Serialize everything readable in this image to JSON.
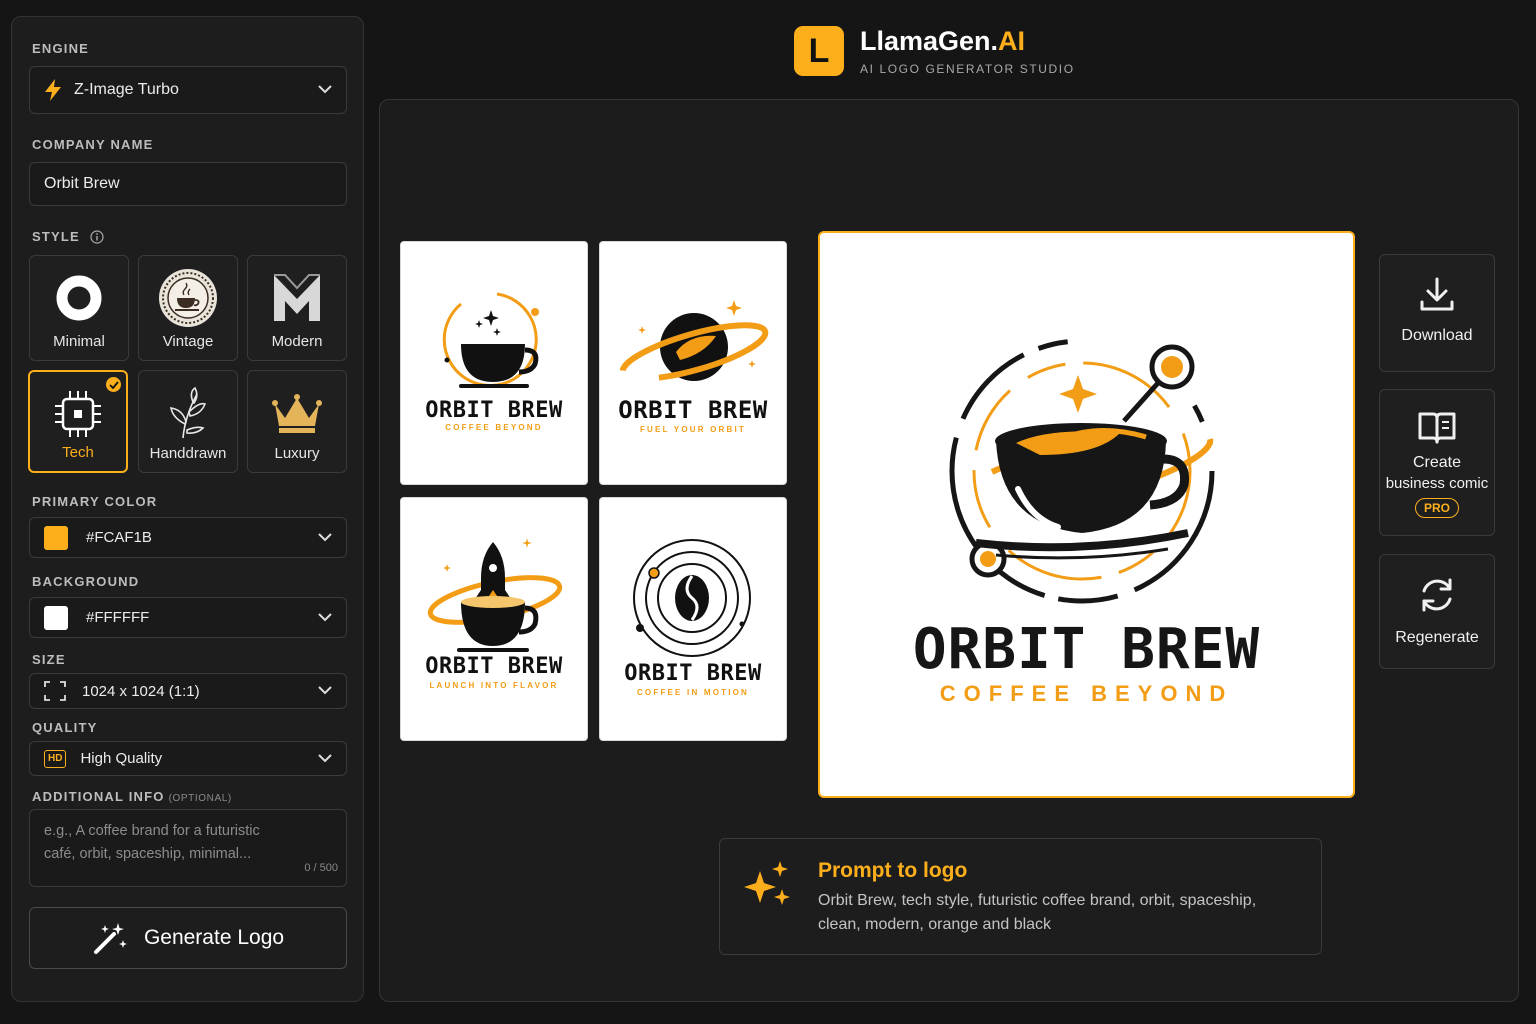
{
  "brand": {
    "name": "LlamaGen.",
    "name_suffix": "AI",
    "subtitle": "AI LOGO GENERATOR STUDIO",
    "mark_letter": "L"
  },
  "sidebar": {
    "engine_label": "ENGINE",
    "engine_value": "Z-Image Turbo",
    "company_label": "COMPANY NAME",
    "company_value": "Orbit Brew",
    "style_label": "STYLE",
    "styles": [
      {
        "name": "Minimal",
        "icon": "circle-ring-icon",
        "selected": false
      },
      {
        "name": "Vintage",
        "icon": "vintage-cup-badge-icon",
        "selected": false
      },
      {
        "name": "Modern",
        "icon": "m-monogram-icon",
        "selected": false
      },
      {
        "name": "Tech",
        "icon": "chip-icon",
        "selected": true
      },
      {
        "name": "Handdrawn",
        "icon": "leaf-sprig-icon",
        "selected": false
      },
      {
        "name": "Luxury",
        "icon": "crown-icon",
        "selected": false
      }
    ],
    "primary_color_label": "PRIMARY COLOR",
    "primary_color_value": "#FCAF1B",
    "background_label": "BACKGROUND",
    "background_value": "#FFFFFF",
    "size_label": "SIZE",
    "size_value": "1024 x 1024 (1:1)",
    "quality_label": "QUALITY",
    "quality_badge": "HD",
    "quality_value": "High Quality",
    "additional_label": "ADDITIONAL INFO",
    "additional_optional": "(OPTIONAL)",
    "additional_placeholder_1": "e.g., A coffee brand for a futuristic",
    "additional_placeholder_2": "café, orbit, spaceship, minimal...",
    "additional_counter": "0 / 500",
    "generate_label": "Generate Logo"
  },
  "thumbnails": [
    {
      "name": "ORBIT BREW",
      "tagline": "COFFEE BEYOND"
    },
    {
      "name": "ORBIT BREW",
      "tagline": "FUEL YOUR ORBIT"
    },
    {
      "name": "ORBIT BREW",
      "tagline": "LAUNCH INTO FLAVOR"
    },
    {
      "name": "ORBIT BREW",
      "tagline": "COFFEE IN MOTION"
    }
  ],
  "main_logo": {
    "name": "ORBIT BREW",
    "tagline": "COFFEE BEYOND"
  },
  "actions": {
    "download_label": "Download",
    "comic_label_1": "Create",
    "comic_label_2": "business comic",
    "comic_badge": "PRO",
    "regenerate_label": "Regenerate"
  },
  "prompt": {
    "title": "Prompt to logo",
    "text": "Orbit Brew, tech style, futuristic coffee brand, orbit, spaceship, clean, modern, orange and black"
  },
  "colors": {
    "accent": "#FCAF1B",
    "panel": "#1D1D1E",
    "background": "#151515"
  }
}
